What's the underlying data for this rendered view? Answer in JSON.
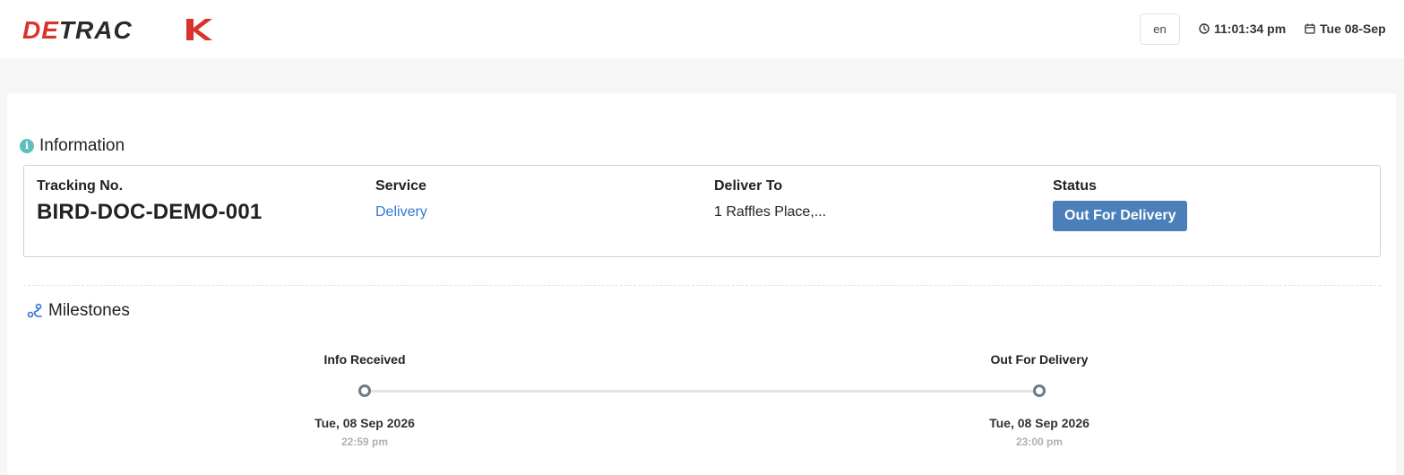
{
  "header": {
    "logo_text": "DETRACK",
    "language": "en",
    "time": "11:01:34 pm",
    "date": "Tue 08-Sep"
  },
  "information": {
    "title": "Information",
    "tracking_label": "Tracking No.",
    "tracking_value": "BIRD-DOC-DEMO-001",
    "service_label": "Service",
    "service_value": "Delivery",
    "deliver_label": "Deliver To",
    "deliver_value": "1 Raffles Place,...",
    "status_label": "Status",
    "status_value": "Out For Delivery"
  },
  "milestones": {
    "title": "Milestones",
    "items": [
      {
        "label": "Info Received",
        "date": "Tue, 08 Sep 2026",
        "time": "22:59 pm"
      },
      {
        "label": "Out For Delivery",
        "date": "Tue, 08 Sep 2026",
        "time": "23:00 pm"
      }
    ]
  },
  "colors": {
    "brand_red": "#d9342b",
    "brand_dark": "#2a2a2a",
    "status_badge": "#4a7fba",
    "link_blue": "#2f7bd6",
    "info_teal": "#5bc0be"
  }
}
